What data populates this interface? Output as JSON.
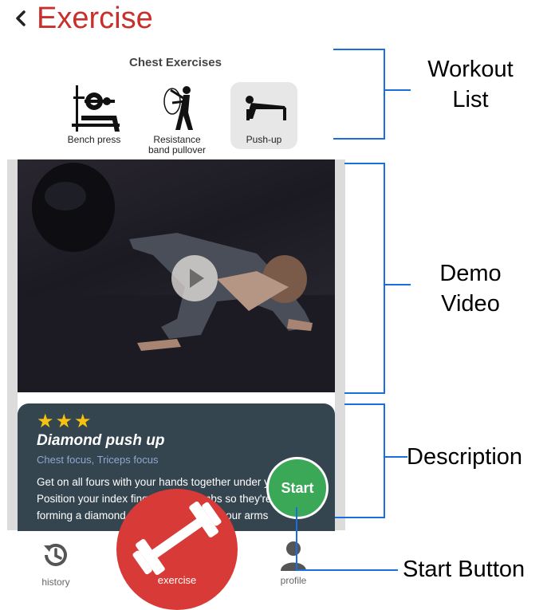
{
  "header": {
    "title": "Exercise"
  },
  "workout_list": {
    "title": "Chest Exercises",
    "items": [
      {
        "label_line1": "Bench press",
        "label_line2": ""
      },
      {
        "label_line1": "Resistance",
        "label_line2": "band pullover"
      },
      {
        "label_line1": "Push-up",
        "label_line2": ""
      }
    ],
    "selected_index": 2
  },
  "description": {
    "stars": "★★★",
    "rating": 3,
    "name": "Diamond push up",
    "focus": "Chest focus, Triceps focus",
    "body": "Get on all fours with your hands together under your chest. Position your index fingers and thumbs so they're touching, forming a diamond shape, and extend your arms"
  },
  "start_button": {
    "label": "Start"
  },
  "nav": {
    "history": "history",
    "exercise": "exercise",
    "profile": "profile"
  },
  "annotations": {
    "workout_list": [
      "Workout",
      "List"
    ],
    "demo_video": [
      "Demo",
      "Video"
    ],
    "description": "Description",
    "start_button": "Start Button"
  },
  "colors": {
    "title_red": "#c9302c",
    "card_bg": "#34454f",
    "star": "#f5c211",
    "start_green": "#3aa857",
    "exercise_red": "#d83a37",
    "annotation_blue": "#1a6fe0"
  }
}
